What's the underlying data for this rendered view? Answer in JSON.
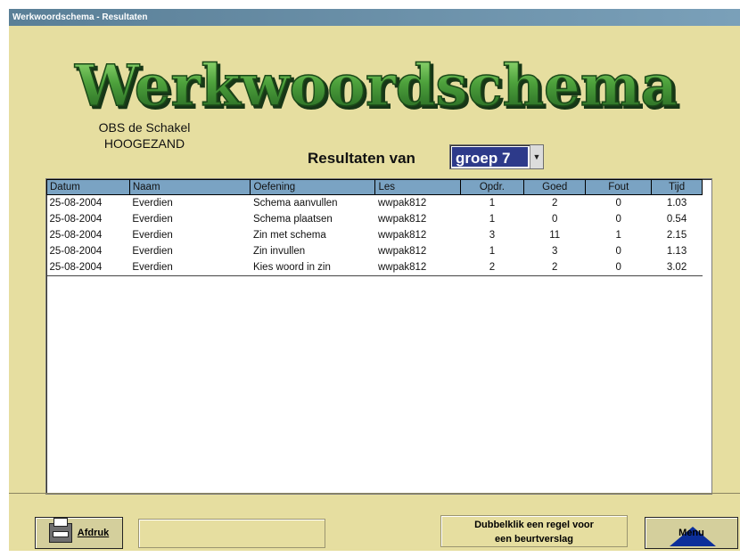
{
  "window": {
    "title": "Werkwoordschema - Resultaten"
  },
  "header": {
    "logo_text": "Werkwoordschema",
    "school_name": "OBS de Schakel",
    "school_city": "HOOGEZAND"
  },
  "filter": {
    "label": "Resultaten van",
    "group_value": "groep 7",
    "group_dropdown_icon": "dropdown-arrow-icon"
  },
  "table": {
    "columns": [
      "Datum",
      "Naam",
      "Oefening",
      "Les",
      "Opdr.",
      "Goed",
      "Fout",
      "Tijd"
    ],
    "rows": [
      [
        "25-08-2004",
        "Everdien",
        "Schema aanvullen",
        "wwpak812",
        "1",
        "2",
        "0",
        "1.03"
      ],
      [
        "25-08-2004",
        "Everdien",
        "Schema plaatsen",
        "wwpak812",
        "1",
        "0",
        "0",
        "0.54"
      ],
      [
        "25-08-2004",
        "Everdien",
        "Zin met schema",
        "wwpak812",
        "3",
        "11",
        "1",
        "2.15"
      ],
      [
        "25-08-2004",
        "Everdien",
        "Zin invullen",
        "wwpak812",
        "1",
        "3",
        "0",
        "1.13"
      ],
      [
        "25-08-2004",
        "Everdien",
        "Kies woord in zin",
        "wwpak812",
        "2",
        "2",
        "0",
        "3.02"
      ]
    ]
  },
  "footer": {
    "print_label": "Afdruk",
    "print_icon": "printer-icon",
    "hint_line1": "Dubbelklik een regel voor",
    "hint_line2": "een beurtverslag",
    "menu_label": "Menu",
    "menu_icon": "triangle-icon"
  },
  "colors": {
    "background": "#e6dea0",
    "titlebar": "#5a7f97",
    "header_row": "#7aa3c3",
    "logo_green": "#4da13c",
    "selection": "#2d3a8a"
  }
}
